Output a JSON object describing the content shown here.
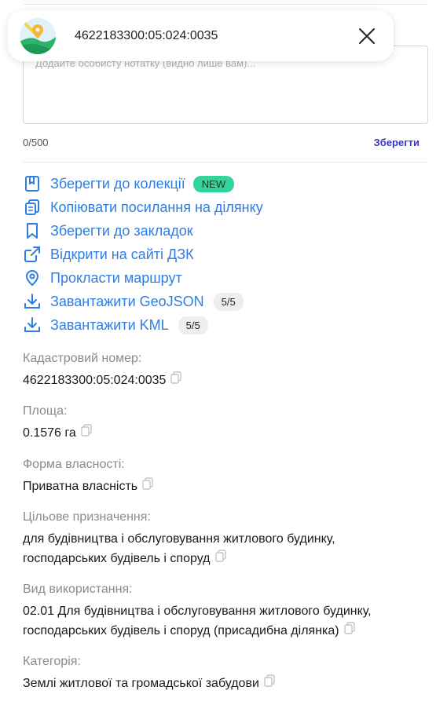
{
  "header": {
    "title": "4622183300:05:024:0035",
    "map_icon": "map-pin-icon",
    "close_icon": "close-icon"
  },
  "note": {
    "placeholder": "Додайте особисту нотатку (видно лише вам)...",
    "value": "",
    "counter": "0/500",
    "save_label": "Зберегти"
  },
  "actions": [
    {
      "label": "Зберегти до колекції",
      "icon": "book-icon",
      "badge": "NEW"
    },
    {
      "label": "Копіювати посилання на ділянку",
      "icon": "clipboard-icon"
    },
    {
      "label": "Зберегти до закладок",
      "icon": "bookmark-icon"
    },
    {
      "label": "Відкрити на сайті ДЗК",
      "icon": "external-link-icon"
    },
    {
      "label": "Прокласти маршрут",
      "icon": "location-pin-icon"
    },
    {
      "label": "Завантажити GeoJSON",
      "icon": "download-icon",
      "badge": "5/5"
    },
    {
      "label": "Завантажити KML",
      "icon": "download-icon",
      "badge": "5/5"
    }
  ],
  "fields": {
    "cadastral": {
      "label": "Кадастровий номер:",
      "value": "4622183300:05:024:0035"
    },
    "area": {
      "label": "Площа:",
      "value": "0.1576 га"
    },
    "ownership": {
      "label": "Форма власності:",
      "value": "Приватна власність"
    },
    "purpose": {
      "label": "Цільове призначення:",
      "line1": "для будівництва і обслуговування житлового будинку,",
      "line2": "господарських будівель і споруд"
    },
    "usage": {
      "label": "Вид використання:",
      "line1": "02.01 Для будівництва і обслуговування житлового будинку,",
      "line2": "господарських будівель і споруд (присадибна ділянка)"
    },
    "category": {
      "label": "Категорія:",
      "value": "Землі житлової та громадської забудови"
    }
  },
  "colors": {
    "link": "#2f7de1",
    "accent": "#3a34c9",
    "new_badge": "#34d399"
  }
}
